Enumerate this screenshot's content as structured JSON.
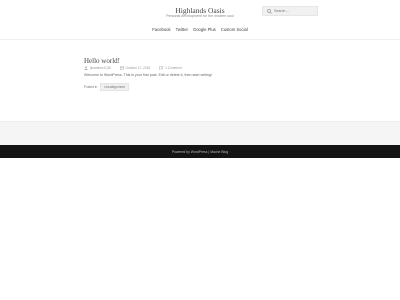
{
  "site": {
    "title": "Highlands Oasis",
    "description": "Personal development for the modern soul"
  },
  "search": {
    "placeholder": "Search ..."
  },
  "social_nav": [
    "Facebook",
    "Twitter",
    "Google Plus",
    "Custom Social"
  ],
  "post": {
    "title": "Hello world!",
    "author": "jlmartinez1138",
    "date": "October 17, 2018",
    "comments": "1 Comment",
    "content": "Welcome to WordPress. This is your first post. Edit or delete it, then start writing!",
    "posted_in_label": "Posted in",
    "category": "Uncategorized"
  },
  "footer": {
    "prefix": "Powered by",
    "wordpress": "WordPress",
    "separator": "|",
    "theme": "Mache Blog"
  },
  "colors": {
    "footer_bg": "#141414",
    "pre_footer_bg": "#f5f5f5",
    "title": "#444444",
    "muted": "#999999"
  },
  "icons": [
    "search-icon",
    "author-icon",
    "calendar-icon",
    "comment-icon"
  ]
}
